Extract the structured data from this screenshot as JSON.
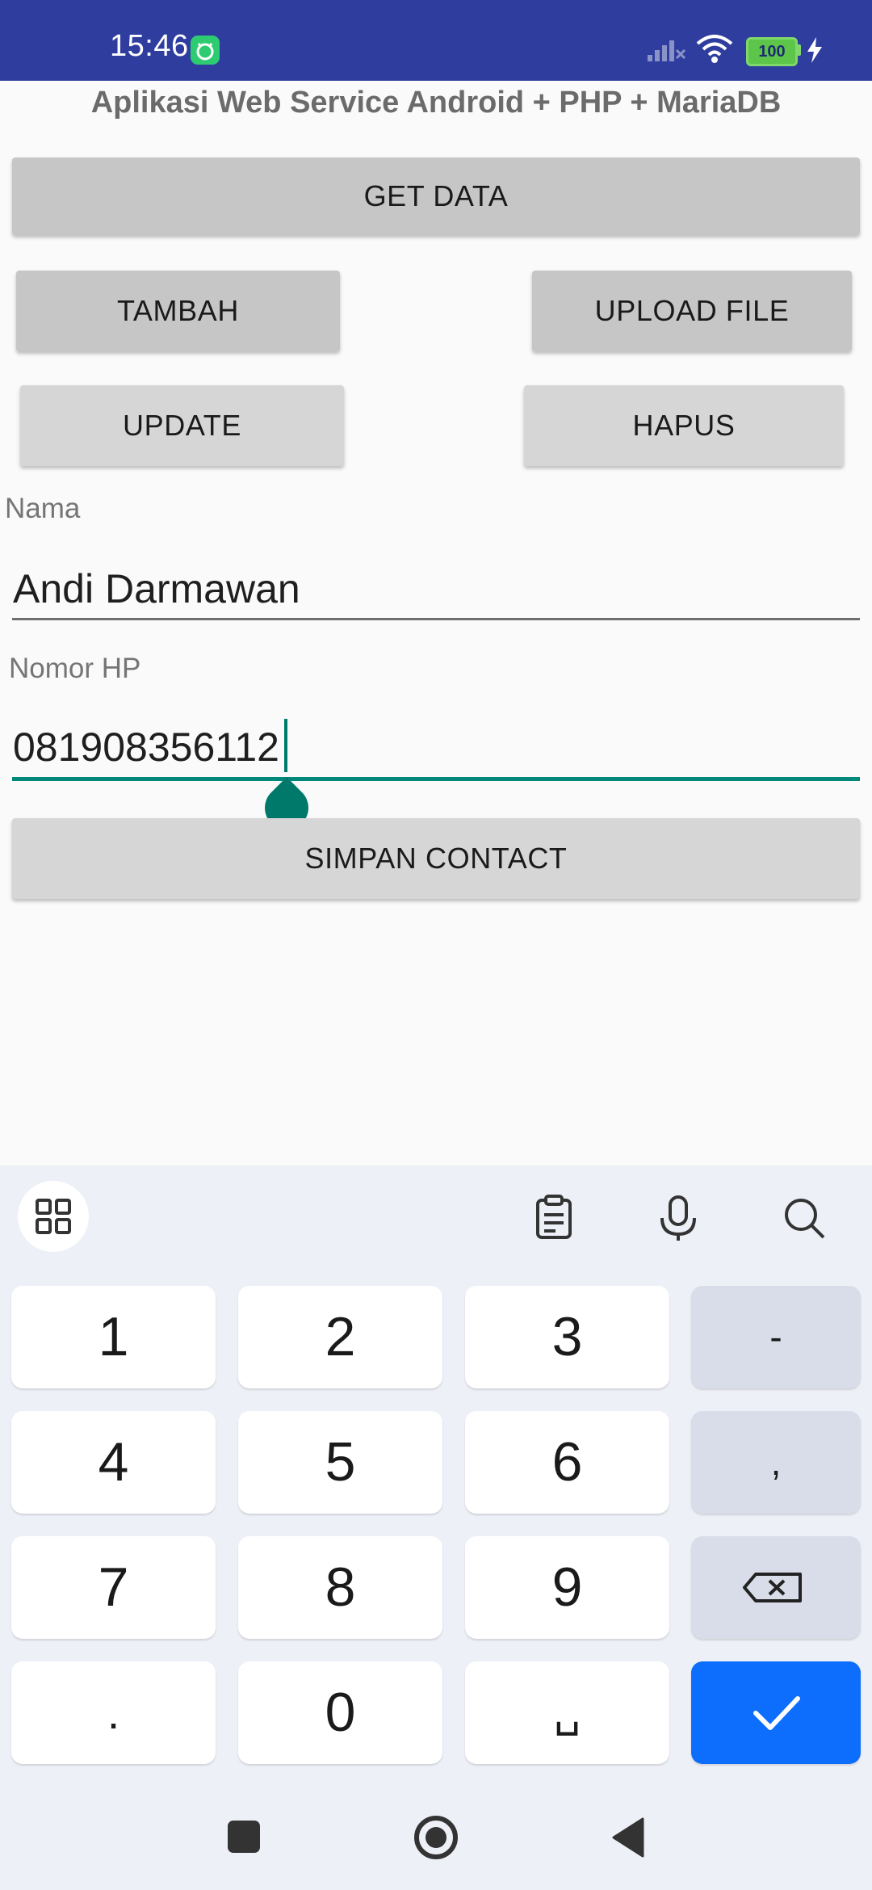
{
  "status_bar": {
    "time": "15:46",
    "battery": "100",
    "background": "#2f3e9e"
  },
  "app": {
    "title": "Aplikasi Web Service Android + PHP + MariaDB",
    "buttons": {
      "get_data": "GET DATA",
      "tambah": "TAMBAH",
      "upload_file": "UPLOAD FILE",
      "update": "UPDATE",
      "hapus": "HAPUS",
      "simpan_contact": "SIMPAN CONTACT"
    },
    "fields": {
      "nama_label": "Nama",
      "nama_value": "Andi Darmawan",
      "nomor_hp_label": "Nomor HP",
      "nomor_hp_value": "081908356112"
    },
    "accent": "#00897b"
  },
  "keyboard": {
    "toolbar_icons": [
      "grid-icon",
      "clipboard-icon",
      "microphone-icon",
      "search-icon"
    ],
    "rows": [
      [
        "1",
        "2",
        "3",
        "-"
      ],
      [
        "4",
        "5",
        "6",
        ","
      ],
      [
        "7",
        "8",
        "9",
        "backspace"
      ],
      [
        ".",
        "0",
        "space",
        "done"
      ]
    ],
    "labels": {
      "k1": "1",
      "k2": "2",
      "k3": "3",
      "dash": "-",
      "k4": "4",
      "k5": "5",
      "k6": "6",
      "comma": ",",
      "k7": "7",
      "k8": "8",
      "k9": "9",
      "dot": ".",
      "k0": "0",
      "space": "␣"
    },
    "done_color": "#0d6efd"
  },
  "nav_bar": {
    "icons": [
      "recents-icon",
      "home-icon",
      "back-icon"
    ]
  }
}
